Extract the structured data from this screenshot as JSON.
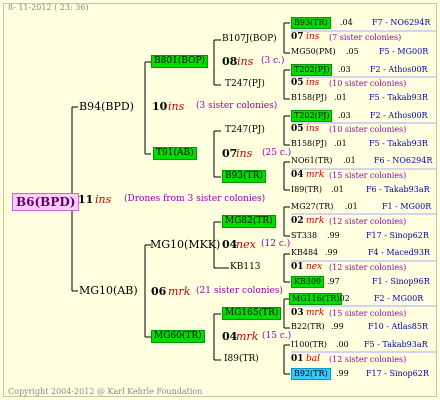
{
  "header": "8- 11-2012 ( 23: 36)",
  "footer": "Copyright 2004-2012 @ Karl Kehrle Foundation",
  "root": {
    "name": "B6(BPD)",
    "num": "11",
    "word": "ins",
    "note": "(Drones from 3 sister colonies)"
  },
  "gen1": [
    {
      "id": "g1a",
      "name": "B94(BPD)",
      "num": "10",
      "word": "ins",
      "note": "(3 sister colonies)"
    },
    {
      "id": "g1b",
      "name": "MG10(AB)",
      "num": "06",
      "word": "mrk",
      "note": "(21 sister colonies)"
    }
  ],
  "gen2": [
    {
      "id": "g2a",
      "name": "B801(BOP)",
      "num": "08",
      "word": "ins",
      "note": "(3 c.)"
    },
    {
      "id": "g2b",
      "name": "T91(AB)",
      "num": "07",
      "word": "ins",
      "note": "(25 c.)"
    },
    {
      "id": "g2c",
      "name": "MG10(MKK)",
      "num": "04",
      "word": "nex",
      "note": "(12 c.)"
    },
    {
      "id": "g2d",
      "name": "MG60(TR)",
      "num": "04",
      "word": "mrk",
      "note": "(15 c.)"
    }
  ],
  "gen3": [
    {
      "name": "B107J(BOP)"
    },
    {
      "name": "T247(PJ)"
    },
    {
      "name": "T247(PJ)"
    },
    {
      "name": "B93(TR)"
    },
    {
      "name": "MG82(TR)"
    },
    {
      "name": "KB113"
    },
    {
      "name": "MG165(TR)"
    },
    {
      "name": "I89(TR)"
    }
  ],
  "rows": [
    {
      "name": "B93(TR)",
      "score": ".04",
      "code": "F7 - NO6294R"
    },
    {
      "num": "07",
      "word": "ins",
      "note": "(7 sister colonies)"
    },
    {
      "name": "MG50(PM)",
      "score": ".05",
      "code": "F5 - MG00R"
    },
    {
      "name": "T202(PJ)",
      "score": ".03",
      "code": "F2 - Athos00R"
    },
    {
      "num": "05",
      "word": "ins",
      "note": "(10 sister colonies)"
    },
    {
      "name": "B158(PJ)",
      "score": ".01",
      "code": "F5 - Takab93R"
    },
    {
      "name": "T202(PJ)",
      "score": ".03",
      "code": "F2 - Athos00R"
    },
    {
      "num": "05",
      "word": "ins",
      "note": "(10 sister colonies)"
    },
    {
      "name": "B158(PJ)",
      "score": ".01",
      "code": "F5 - Takab93R"
    },
    {
      "name": "NO61(TR)",
      "score": ".01",
      "code": "F6 - NO6294R"
    },
    {
      "num": "04",
      "word": "mrk",
      "note": "(15 sister colonies)"
    },
    {
      "name": "I89(TR)",
      "score": ".01",
      "code": "F6 - Takab93aR"
    },
    {
      "name": "MG27(TR)",
      "score": ".01",
      "code": "F1 - MG00R"
    },
    {
      "num": "02",
      "word": "mrk",
      "note": "(12 sister colonies)"
    },
    {
      "name": "ST338",
      "score": ".99",
      "code": "F17 - Sinop62R"
    },
    {
      "name": "KB484",
      "score": ".99",
      "code": "F4 - Maced93R"
    },
    {
      "num": "01",
      "word": "nex",
      "note": "(12 sister colonies)"
    },
    {
      "name": "KB309",
      "score": ".97",
      "code": "F1 - Sinop96R"
    },
    {
      "name": "MG116(TR)",
      "score": ".02",
      "code": "F2 - MG00R"
    },
    {
      "num": "03",
      "word": "mrk",
      "note": "(15 sister colonies)"
    },
    {
      "name": "B22(TR)",
      "score": ".99",
      "code": "F10 - Atlas85R"
    },
    {
      "name": "I100(TR)",
      "score": ".00",
      "code": "F5 - Takab93aR"
    },
    {
      "num": "01",
      "word": "bal",
      "note": "(12 sister colonies)"
    },
    {
      "name": "B92(TR)",
      "score": ".99",
      "code": "F17 - Sinop62R"
    }
  ]
}
